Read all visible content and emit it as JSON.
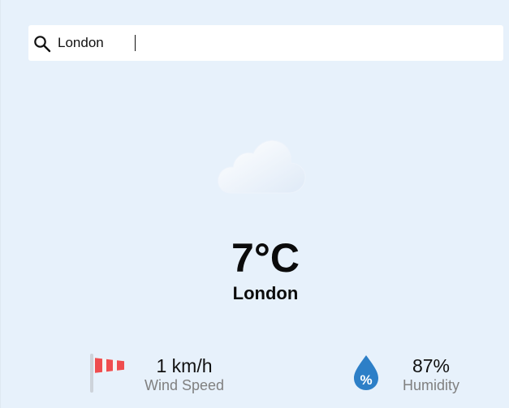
{
  "search": {
    "value": "London",
    "icon": "search-icon"
  },
  "weather": {
    "icon": "cloud-icon",
    "temperature": "7°C",
    "city": "London"
  },
  "metrics": {
    "wind": {
      "icon": "windsock-icon",
      "value": "1 km/h",
      "label": "Wind Speed"
    },
    "humidity": {
      "icon": "humidity-drop-icon",
      "value": "87%",
      "label": "Humidity",
      "icon_symbol": "%"
    }
  },
  "colors": {
    "background": "#e7f1fb",
    "search_bg": "#ffffff",
    "wind_red": "#ef4d4f",
    "drop_blue": "#2d7fc7"
  }
}
